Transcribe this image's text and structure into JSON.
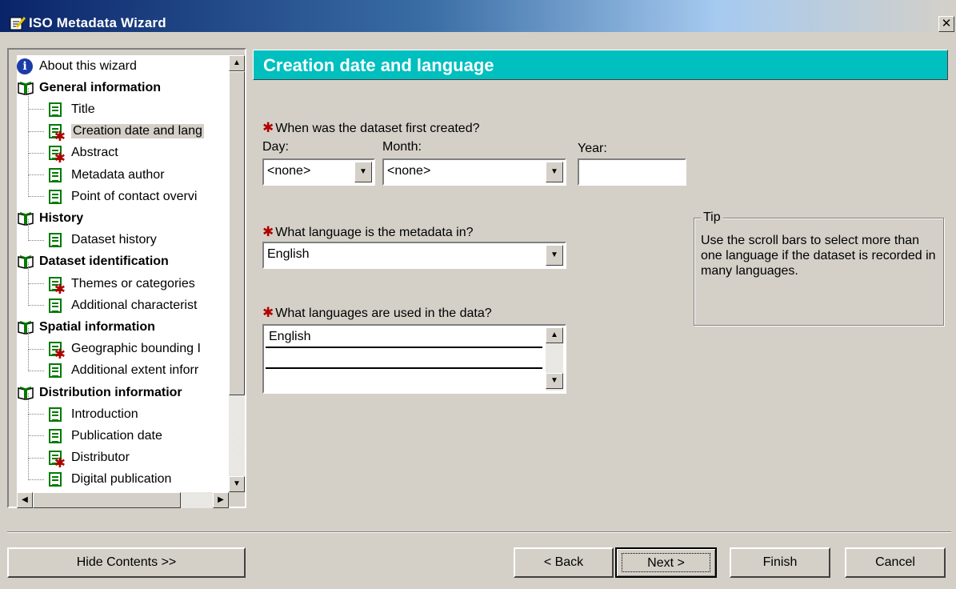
{
  "window": {
    "title": "ISO Metadata Wizard",
    "close_glyph": "✕"
  },
  "tree": {
    "items": [
      {
        "label": "About this wizard",
        "icon": "info-icon",
        "bold": false,
        "required": false,
        "indent": false
      },
      {
        "label": "General information",
        "icon": "book-icon",
        "bold": true,
        "required": false,
        "indent": false
      },
      {
        "label": "Title",
        "icon": "document-icon",
        "bold": false,
        "required": false,
        "indent": true
      },
      {
        "label": "Creation date and lang",
        "icon": "document-icon",
        "bold": false,
        "required": true,
        "indent": true,
        "selected": true
      },
      {
        "label": "Abstract",
        "icon": "document-icon",
        "bold": false,
        "required": true,
        "indent": true
      },
      {
        "label": "Metadata author",
        "icon": "document-icon",
        "bold": false,
        "required": false,
        "indent": true
      },
      {
        "label": "Point of contact overvi",
        "icon": "document-icon",
        "bold": false,
        "required": false,
        "indent": true
      },
      {
        "label": "History",
        "icon": "book-icon",
        "bold": true,
        "required": false,
        "indent": false
      },
      {
        "label": "Dataset history",
        "icon": "document-icon",
        "bold": false,
        "required": false,
        "indent": true
      },
      {
        "label": "Dataset identification",
        "icon": "book-icon",
        "bold": true,
        "required": false,
        "indent": false
      },
      {
        "label": "Themes or categories",
        "icon": "document-icon",
        "bold": false,
        "required": true,
        "indent": true
      },
      {
        "label": "Additional characterist",
        "icon": "document-icon",
        "bold": false,
        "required": false,
        "indent": true
      },
      {
        "label": "Spatial information",
        "icon": "book-icon",
        "bold": true,
        "required": false,
        "indent": false
      },
      {
        "label": "Geographic bounding I",
        "icon": "document-icon",
        "bold": false,
        "required": true,
        "indent": true
      },
      {
        "label": "Additional extent inforr",
        "icon": "document-icon",
        "bold": false,
        "required": false,
        "indent": true
      },
      {
        "label": "Distribution informatior",
        "icon": "book-icon",
        "bold": true,
        "required": false,
        "indent": false
      },
      {
        "label": "Introduction",
        "icon": "document-icon",
        "bold": false,
        "required": false,
        "indent": true
      },
      {
        "label": "Publication date",
        "icon": "document-icon",
        "bold": false,
        "required": false,
        "indent": true
      },
      {
        "label": "Distributor",
        "icon": "document-icon",
        "bold": false,
        "required": true,
        "indent": true
      },
      {
        "label": "Digital publication",
        "icon": "document-icon",
        "bold": false,
        "required": false,
        "indent": true
      }
    ]
  },
  "page": {
    "heading": "Creation date and language",
    "q1": {
      "label": "When was the dataset first created?",
      "day_label": "Day:",
      "day_value": "<none>",
      "month_label": "Month:",
      "month_value": "<none>",
      "year_label": "Year:",
      "year_value": ""
    },
    "q2": {
      "label": "What language is the metadata in?",
      "value": "English"
    },
    "q3": {
      "label": "What languages are used in the data?",
      "rows": [
        "English",
        "",
        ""
      ]
    },
    "tip": {
      "title": "Tip",
      "text": "Use the scroll bars to select more than one language if the dataset is recorded in many languages."
    }
  },
  "buttons": {
    "hide_contents": "Hide Contents >>",
    "back": "< Back",
    "next": "Next >",
    "finish": "Finish",
    "cancel": "Cancel"
  },
  "colors": {
    "heading_bg": "#00bfbf",
    "required_star": "#b00000",
    "doc_icon": "#007a00"
  }
}
